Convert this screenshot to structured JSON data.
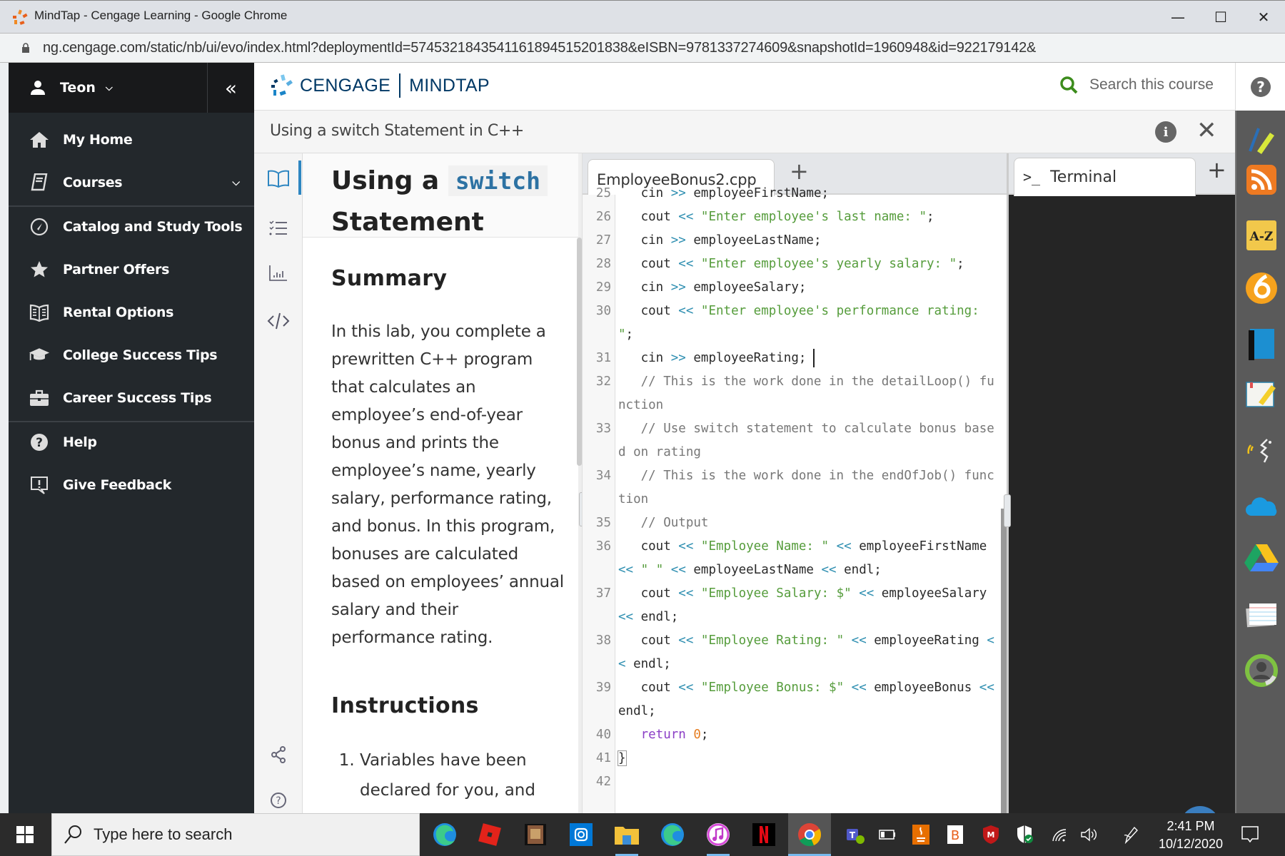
{
  "window": {
    "title": "MindTap - Cengage Learning - Google Chrome",
    "url": "ng.cengage.com/static/nb/ui/evo/index.html?deploymentId=5745321843541161894515201838&eISBN=9781337274609&snapshotId=1960948&id=922179142&",
    "controls": {
      "minimize": "—",
      "maximize": "☐",
      "close": "✕"
    }
  },
  "nav": {
    "user": "Teon",
    "collapse_icon": "«",
    "items": [
      {
        "label": "My Home",
        "icon": "home-icon"
      },
      {
        "label": "Courses",
        "icon": "book-icon",
        "has_dropdown": true
      },
      {
        "label": "Catalog and Study Tools",
        "icon": "compass-icon"
      },
      {
        "label": "Partner Offers",
        "icon": "star-icon"
      },
      {
        "label": "Rental Options",
        "icon": "open-book-icon"
      },
      {
        "label": "College Success Tips",
        "icon": "graduation-cap-icon"
      },
      {
        "label": "Career Success Tips",
        "icon": "briefcase-icon"
      },
      {
        "label": "Help",
        "icon": "help-circle-icon"
      },
      {
        "label": "Give Feedback",
        "icon": "feedback-icon"
      }
    ]
  },
  "header": {
    "brand": "CENGAGE",
    "product": "MINDTAP",
    "search_placeholder": "Search this course",
    "help_icon": "?"
  },
  "activity": {
    "title": "Using a switch Statement in C++",
    "info_icon": "i",
    "close_icon": "✕"
  },
  "doc": {
    "title_prefix": "Using a",
    "title_code": "switch",
    "title_suffix": "Statement",
    "summary_heading": "Summary",
    "summary_text": "In this lab, you complete a prewritten C++ program that calculates an employee’s end-of-year bonus and prints the employee’s name, yearly salary, performance rating, and bonus. In this program, bonuses are calculated based on employees’ annual salary and their performance rating.",
    "instructions_heading": "Instructions",
    "instructions": [
      "Variables have been declared for you, and"
    ]
  },
  "editor": {
    "tab": "EmployeeBonus2.cpp",
    "add": "+",
    "lines": [
      {
        "n": "25",
        "parts": [
          [
            "",
            "   cin "
          ],
          [
            "op",
            ">>"
          ],
          [
            "",
            " employeeFirstName;"
          ]
        ]
      },
      {
        "n": "26",
        "parts": [
          [
            "",
            "   cout "
          ],
          [
            "op",
            "<<"
          ],
          [
            "",
            " "
          ],
          [
            "str",
            "\"Enter employee's last name: \""
          ],
          [
            "",
            ";"
          ]
        ]
      },
      {
        "n": "27",
        "parts": [
          [
            "",
            "   cin "
          ],
          [
            "op",
            ">>"
          ],
          [
            "",
            " employeeLastName;"
          ]
        ]
      },
      {
        "n": "28",
        "parts": [
          [
            "",
            "   cout "
          ],
          [
            "op",
            "<<"
          ],
          [
            "",
            " "
          ],
          [
            "str",
            "\"Enter employee's yearly salary: \""
          ],
          [
            "",
            ";"
          ]
        ]
      },
      {
        "n": "29",
        "parts": [
          [
            "",
            "   cin "
          ],
          [
            "op",
            ">>"
          ],
          [
            "",
            " employeeSalary;"
          ]
        ]
      },
      {
        "n": "30",
        "parts": [
          [
            "",
            "   cout "
          ],
          [
            "op",
            "<<"
          ],
          [
            "",
            " "
          ],
          [
            "str",
            "\"Enter employee's performance rating: \""
          ],
          [
            "",
            ";"
          ]
        ]
      },
      {
        "n": "31",
        "parts": [
          [
            "",
            "   cin "
          ],
          [
            "op",
            ">>"
          ],
          [
            "",
            " employeeRating;"
          ],
          [
            "cursor",
            ""
          ]
        ]
      },
      {
        "n": "32",
        "parts": [
          [
            "cm",
            "   // This is the work done in the detailLoop() function"
          ]
        ]
      },
      {
        "n": "33",
        "parts": [
          [
            "cm",
            "   // Use switch statement to calculate bonus based on rating"
          ]
        ]
      },
      {
        "n": "34",
        "parts": [
          [
            "cm",
            "   // This is the work done in the endOfJob() function"
          ]
        ]
      },
      {
        "n": "35",
        "parts": [
          [
            "cm",
            "   // Output"
          ]
        ]
      },
      {
        "n": "36",
        "parts": [
          [
            "",
            "   cout "
          ],
          [
            "op",
            "<<"
          ],
          [
            "",
            " "
          ],
          [
            "str",
            "\"Employee Name: \""
          ],
          [
            "",
            " "
          ],
          [
            "op",
            "<<"
          ],
          [
            "",
            " employeeFirstName "
          ],
          [
            "op",
            "<<"
          ],
          [
            "",
            " "
          ],
          [
            "str",
            "\" \""
          ],
          [
            "",
            " "
          ],
          [
            "op",
            "<<"
          ],
          [
            "",
            " employeeLastName "
          ],
          [
            "op",
            "<<"
          ],
          [
            "",
            " endl;"
          ]
        ]
      },
      {
        "n": "37",
        "parts": [
          [
            "",
            "   cout "
          ],
          [
            "op",
            "<<"
          ],
          [
            "",
            " "
          ],
          [
            "str",
            "\"Employee Salary: $\""
          ],
          [
            "",
            " "
          ],
          [
            "op",
            "<<"
          ],
          [
            "",
            " employeeSalary "
          ],
          [
            "op",
            "<<"
          ],
          [
            "",
            " endl;"
          ]
        ]
      },
      {
        "n": "38",
        "parts": [
          [
            "",
            "   cout "
          ],
          [
            "op",
            "<<"
          ],
          [
            "",
            " "
          ],
          [
            "str",
            "\"Employee Rating: \""
          ],
          [
            "",
            " "
          ],
          [
            "op",
            "<<"
          ],
          [
            "",
            " employeeRating "
          ],
          [
            "op",
            "<<"
          ],
          [
            "",
            " endl;"
          ]
        ]
      },
      {
        "n": "39",
        "parts": [
          [
            "",
            "   cout "
          ],
          [
            "op",
            "<<"
          ],
          [
            "",
            " "
          ],
          [
            "str",
            "\"Employee Bonus: $\""
          ],
          [
            "",
            " "
          ],
          [
            "op",
            "<<"
          ],
          [
            "",
            " employeeBonus "
          ],
          [
            "op",
            "<<"
          ],
          [
            "",
            " endl;"
          ]
        ]
      },
      {
        "n": "40",
        "parts": [
          [
            "kw",
            "   return"
          ],
          [
            "",
            " "
          ],
          [
            "num",
            "0"
          ],
          [
            "",
            ";"
          ]
        ]
      },
      {
        "n": "41",
        "parts": [
          [
            "bracket",
            "}"
          ]
        ]
      },
      {
        "n": "42",
        "parts": [
          [
            "",
            ""
          ]
        ]
      }
    ]
  },
  "terminal": {
    "tab": "Terminal",
    "prompt_icon": ">_",
    "add": "+"
  },
  "right_tools": [
    "highlighter-icon",
    "rss-icon",
    "glossary-az-icon",
    "app-6-icon",
    "ebook-icon",
    "notes-icon",
    "readspeaker-icon",
    "onedrive-icon",
    "google-drive-icon",
    "flashcards-icon",
    "progress-icon"
  ],
  "taskbar": {
    "search_placeholder": "Type here to search",
    "apps": [
      "edge-icon",
      "roblox-icon",
      "game-icon",
      "camera-app-icon",
      "file-explorer-icon",
      "edge-icon",
      "itunes-icon",
      "netflix-icon",
      "chrome-icon"
    ],
    "time": "2:41 PM",
    "date": "10/12/2020"
  }
}
